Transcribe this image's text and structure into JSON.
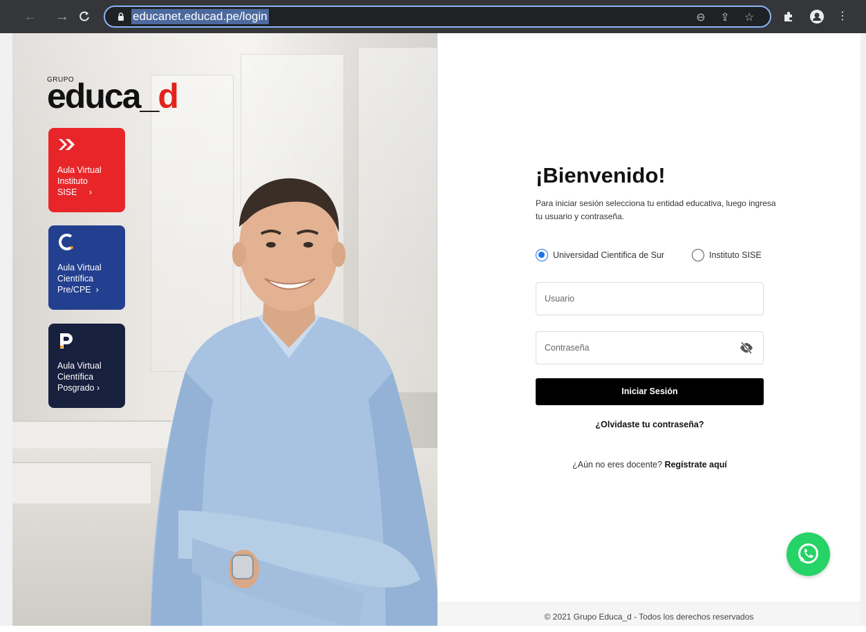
{
  "browser": {
    "url": "educanet.educad.pe/login",
    "back_icon": "←",
    "forward_icon": "→",
    "reload_icon": "C",
    "zoom_icon": "⊖",
    "share_icon": "⇪",
    "star_icon": "☆",
    "menu_icon": "⋮"
  },
  "logo": {
    "grupo": "GRUPO",
    "name_main": "educa",
    "name_underscore": "_",
    "name_d": "d"
  },
  "cards": [
    {
      "label_1": "Aula Virtual",
      "label_2": "Instituto",
      "label_3": "SISE",
      "arrow": "›",
      "color": "#e8262a"
    },
    {
      "label_1": "Aula Virtual",
      "label_2": "Científica",
      "label_3": "Pre/CPE",
      "arrow": "›",
      "color": "#233f8f"
    },
    {
      "label_1": "Aula Virtual",
      "label_2": "Científica",
      "label_3": "Posgrado",
      "arrow": "›",
      "color": "#17203d"
    }
  ],
  "login": {
    "title": "¡Bienvenido!",
    "subtitle": "Para iniciar sesión selecciona tu entidad educativa, luego ingresa tu usuario y contraseña.",
    "radio_1": "Universidad Cientifica de Sur",
    "radio_2": "Instituto SISE",
    "radio_selected": "Universidad Cientifica de Sur",
    "user_placeholder": "Usuario",
    "password_placeholder": "Contraseña",
    "submit": "Iniciar Sesión",
    "forgot": "¿Olvidaste tu contraseña?",
    "register_prefix": "¿Aún no eres docente?",
    "register_link": "Regístrate aquí",
    "footer": "© 2021 Grupo Educa_d - Todos los derechos reservados"
  },
  "colors": {
    "accent": "#1a73e8",
    "whatsapp": "#25d366",
    "brand_red": "#e2231a"
  }
}
